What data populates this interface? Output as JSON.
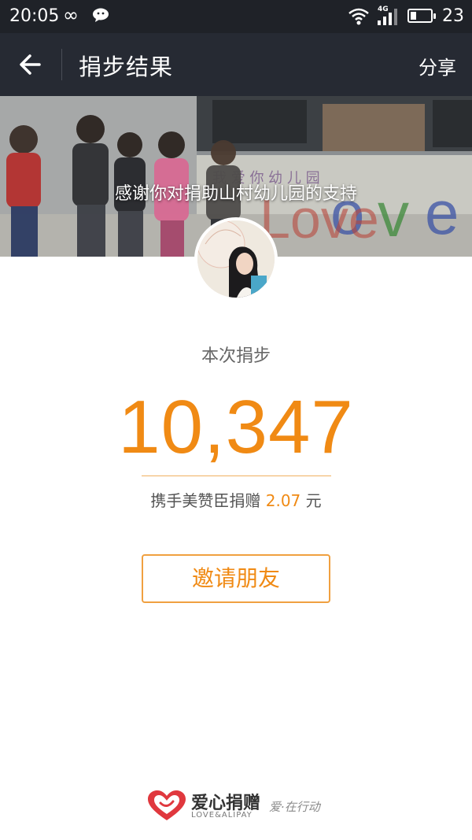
{
  "status_bar": {
    "time": "20:05",
    "network": "4G",
    "battery_percent": "23"
  },
  "header": {
    "title": "捐步结果",
    "share_label": "分享"
  },
  "banner": {
    "caption": "感谢你对捐助山村幼儿园的支持",
    "wall_text": "我 爱 你 幼 儿 园",
    "wall_love": "Love"
  },
  "result": {
    "label": "本次捐步",
    "steps": "10,347",
    "sponsor_prefix": "携手美赞臣捐赠",
    "amount": "2.07",
    "currency": "元"
  },
  "invite_button_label": "邀请朋友",
  "footer": {
    "brand_name": "爱心捐赠",
    "brand_sub": "LOVE&ALIPAY",
    "slogan": "爱·在行动"
  },
  "colors": {
    "accent": "#f08a14",
    "header_bg": "#262a33",
    "statusbar_bg": "#1f2228",
    "brand_red": "#e0383e"
  },
  "icons": {
    "back": "back-arrow-icon",
    "wechat": "wechat-icon",
    "wifi": "wifi-icon",
    "signal": "signal-icon",
    "battery": "battery-icon",
    "heart": "heart-logo-icon"
  }
}
